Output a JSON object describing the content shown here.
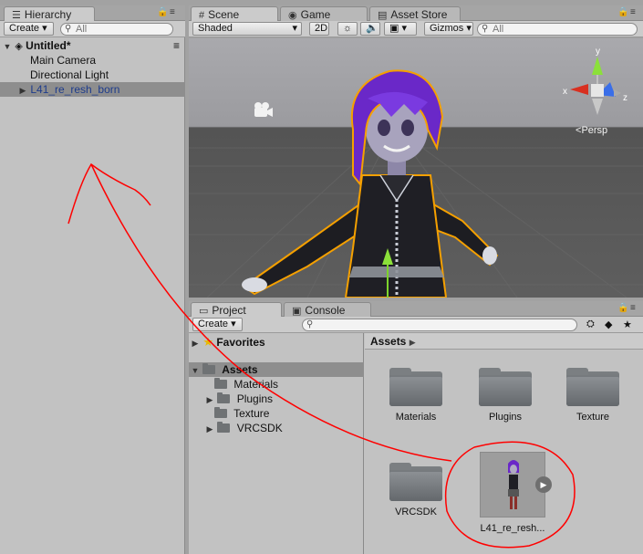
{
  "hierarchy": {
    "tab_label": "Hierarchy",
    "create_label": "Create",
    "search_placeholder": "All",
    "scene_name": "Untitled*",
    "items": [
      {
        "label": "Main Camera"
      },
      {
        "label": "Directional Light"
      },
      {
        "label": "L41_re_resh_born"
      }
    ]
  },
  "scene": {
    "tabs": [
      {
        "label": "Scene",
        "icon": "hash-icon"
      },
      {
        "label": "Game",
        "icon": "game-icon"
      },
      {
        "label": "Asset Store",
        "icon": "store-icon"
      }
    ],
    "toolbar": {
      "shading": "Shaded",
      "mode_2d": "2D",
      "gizmos": "Gizmos",
      "search_placeholder": "All"
    },
    "gizmo": {
      "y": "y",
      "x": "x",
      "z": "z",
      "projection": "Persp"
    }
  },
  "project": {
    "tabs": [
      {
        "label": "Project",
        "icon": "folder-icon"
      },
      {
        "label": "Console",
        "icon": "console-icon"
      }
    ],
    "create_label": "Create",
    "tree": {
      "favorites": "Favorites",
      "assets": "Assets",
      "children": [
        "Materials",
        "Plugins",
        "Texture",
        "VRCSDK"
      ]
    },
    "breadcrumb": "Assets",
    "assets": [
      {
        "label": "Materials",
        "type": "folder"
      },
      {
        "label": "Plugins",
        "type": "folder"
      },
      {
        "label": "Texture",
        "type": "folder"
      },
      {
        "label": "VRCSDK",
        "type": "folder"
      },
      {
        "label": "L41_re_resh...",
        "type": "model"
      }
    ]
  },
  "colors": {
    "annotation": "#ff0000",
    "selection_outline": "#f5a000",
    "hair": "#6a28c8"
  }
}
